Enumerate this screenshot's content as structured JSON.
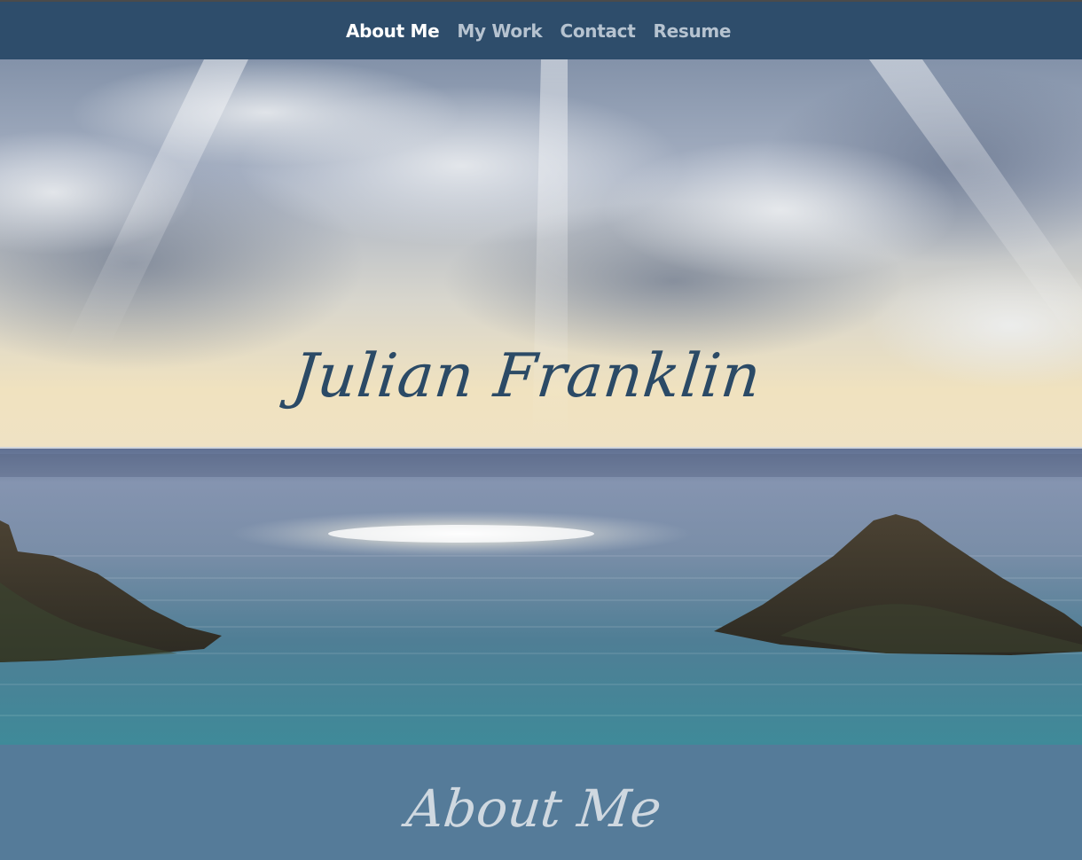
{
  "nav": {
    "items": [
      {
        "label": "About Me",
        "active": true
      },
      {
        "label": "My Work",
        "active": false
      },
      {
        "label": "Contact",
        "active": false
      },
      {
        "label": "Resume",
        "active": false
      }
    ]
  },
  "hero": {
    "name": "Julian Franklin"
  },
  "about": {
    "title": "About Me"
  },
  "colors": {
    "navbar": "#2e4d6b",
    "nav_active": "#ffffff",
    "nav_inactive": "#b6c3d0",
    "hero_name": "#2b4a66",
    "about_bg": "#557b99",
    "about_title": "#cfd8e0"
  }
}
